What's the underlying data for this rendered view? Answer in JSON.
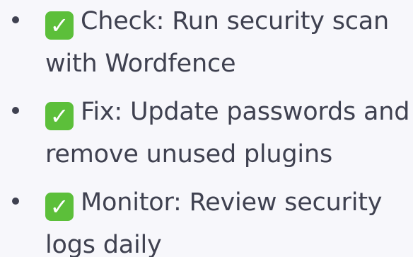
{
  "items": [
    {
      "icon": "white-check-mark-icon",
      "glyph": "✓",
      "label": "Check:",
      "text": "Run security scan with Wordfence"
    },
    {
      "icon": "white-check-mark-icon",
      "glyph": "✓",
      "label": "Fix:",
      "text": "Update passwords and remove unused plugins"
    },
    {
      "icon": "white-check-mark-icon",
      "glyph": "✓",
      "label": "Monitor:",
      "text": "Review security logs daily"
    }
  ],
  "colors": {
    "text": "#3f4150",
    "check_background": "#5cbf3a",
    "page_background": "#f7f7fb"
  }
}
